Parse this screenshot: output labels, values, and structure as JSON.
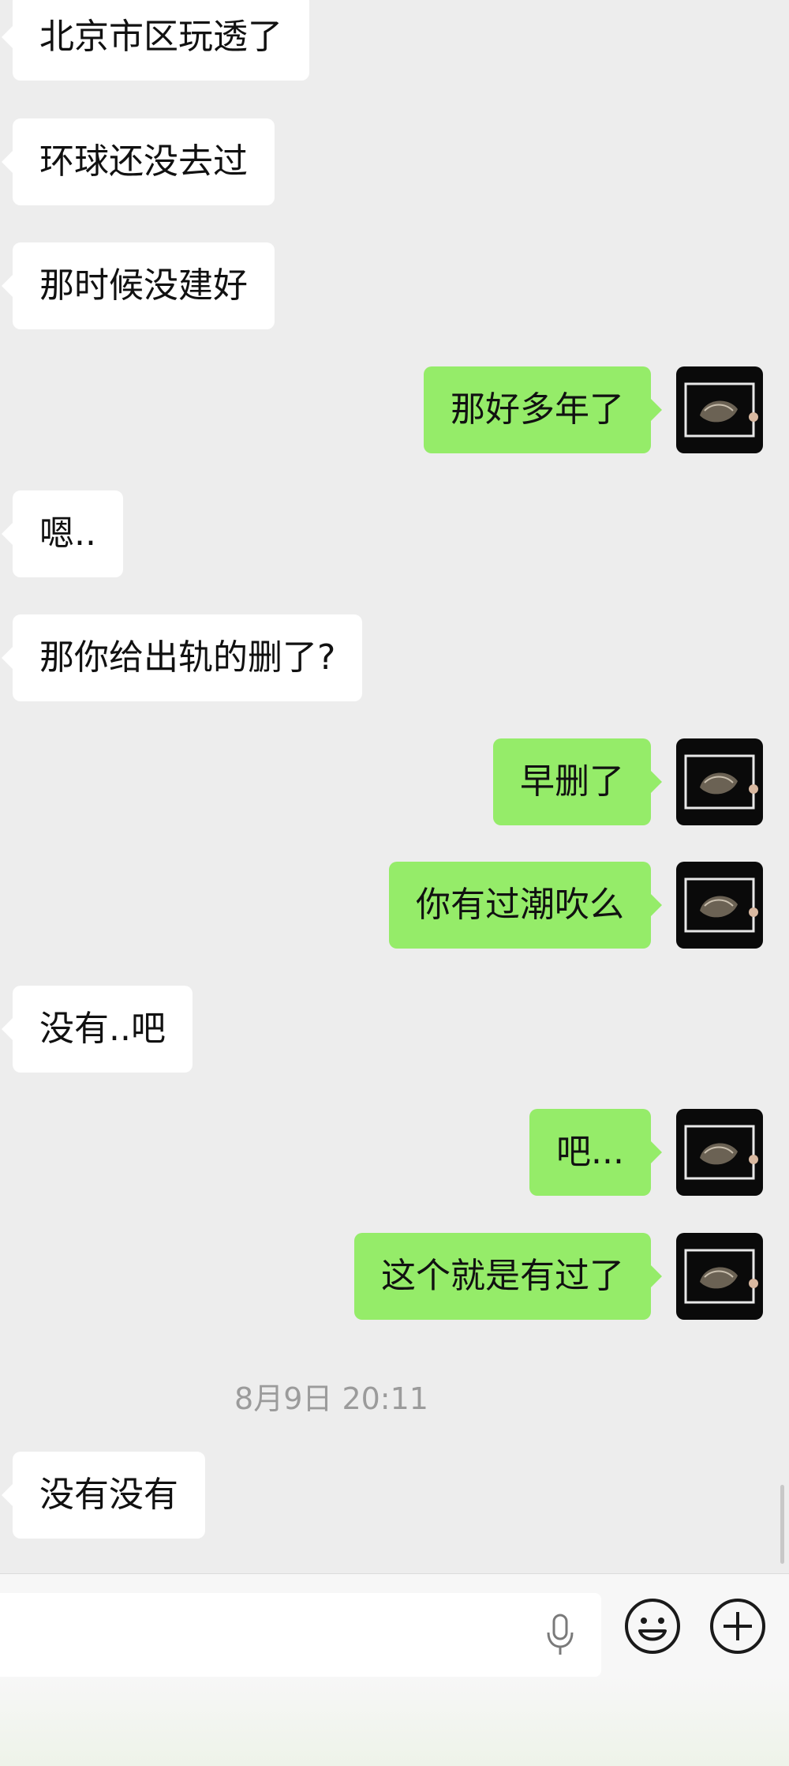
{
  "messages": [
    {
      "side": "left",
      "text": "北京市区玩透了"
    },
    {
      "side": "left",
      "text": "环球还没去过"
    },
    {
      "side": "left",
      "text": "那时候没建好"
    },
    {
      "side": "right",
      "text": "那好多年了"
    },
    {
      "side": "left",
      "text": "嗯.."
    },
    {
      "side": "left",
      "text": "那你给出轨的删了?"
    },
    {
      "side": "right",
      "text": "早删了"
    },
    {
      "side": "right",
      "text": "你有过潮吹么"
    },
    {
      "side": "left",
      "text": "没有..吧"
    },
    {
      "side": "right",
      "text": "吧..."
    },
    {
      "side": "right",
      "text": "这个就是有过了"
    },
    {
      "side": "left",
      "text": "没有没有"
    }
  ],
  "timestamp": "8月9日 20:11",
  "colors": {
    "background": "#ededed",
    "left_bubble": "#ffffff",
    "right_bubble": "#95ec69",
    "timestamp_text": "#9b9b9b"
  },
  "input_bar": {
    "mic_icon": "microphone-icon",
    "emoji_icon": "emoji-icon",
    "plus_icon": "plus-icon"
  }
}
